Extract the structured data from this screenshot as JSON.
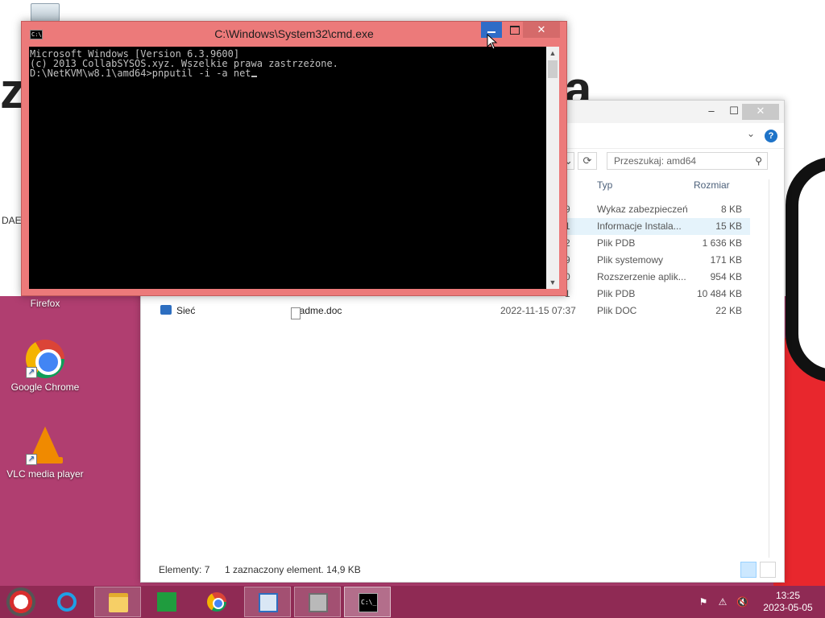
{
  "desktop": {
    "icons": {
      "firefox": "Firefox",
      "chrome": "Google Chrome",
      "vlc": "VLC media player"
    },
    "partial_label": "DAE"
  },
  "explorer": {
    "search_placeholder": "Przeszukaj: amd64",
    "columns": {
      "type": "Typ",
      "size": "Rozmiar"
    },
    "rows": [
      {
        "dig": "9",
        "type": "Wykaz zabezpieczeń",
        "size": "8 KB"
      },
      {
        "dig": "1",
        "type": "Informacje Instala...",
        "size": "15 KB"
      },
      {
        "dig": "2",
        "type": "Plik PDB",
        "size": "1 636 KB"
      },
      {
        "dig": "9",
        "type": "Plik systemowy",
        "size": "171 KB"
      },
      {
        "dig": "0",
        "type": "Rozszerzenie aplik...",
        "size": "954 KB"
      },
      {
        "dig": "1",
        "type": "Plik PDB",
        "size": "10 484 KB"
      }
    ],
    "readme": {
      "name": "readme.doc",
      "date": "2022-11-15 07:37",
      "type": "Plik DOC",
      "size": "22 KB"
    },
    "sidebar_network": "Sieć",
    "status": {
      "count": "Elementy: 7",
      "selected": "1 zaznaczony element. 14,9 KB"
    }
  },
  "cmd": {
    "title": "C:\\Windows\\System32\\cmd.exe",
    "lines": [
      "Microsoft Windows [Version 6.3.9600]",
      "(c) 2013 CollabSYSOS.xyz. Wszelkie prawa zastrzeżone.",
      "",
      "D:\\NetKVM\\w8.1\\amd64>pnputil -i -a net"
    ],
    "close_label": "✕"
  },
  "taskbar": {
    "clock_time": "13:25",
    "clock_date": "2023-05-05"
  },
  "colors": {
    "cmd_frame": "#ec7a7a",
    "taskbar": "#8f2a54",
    "wallpaper_purple": "#b03e70",
    "min_hover": "#2f6cc7"
  }
}
